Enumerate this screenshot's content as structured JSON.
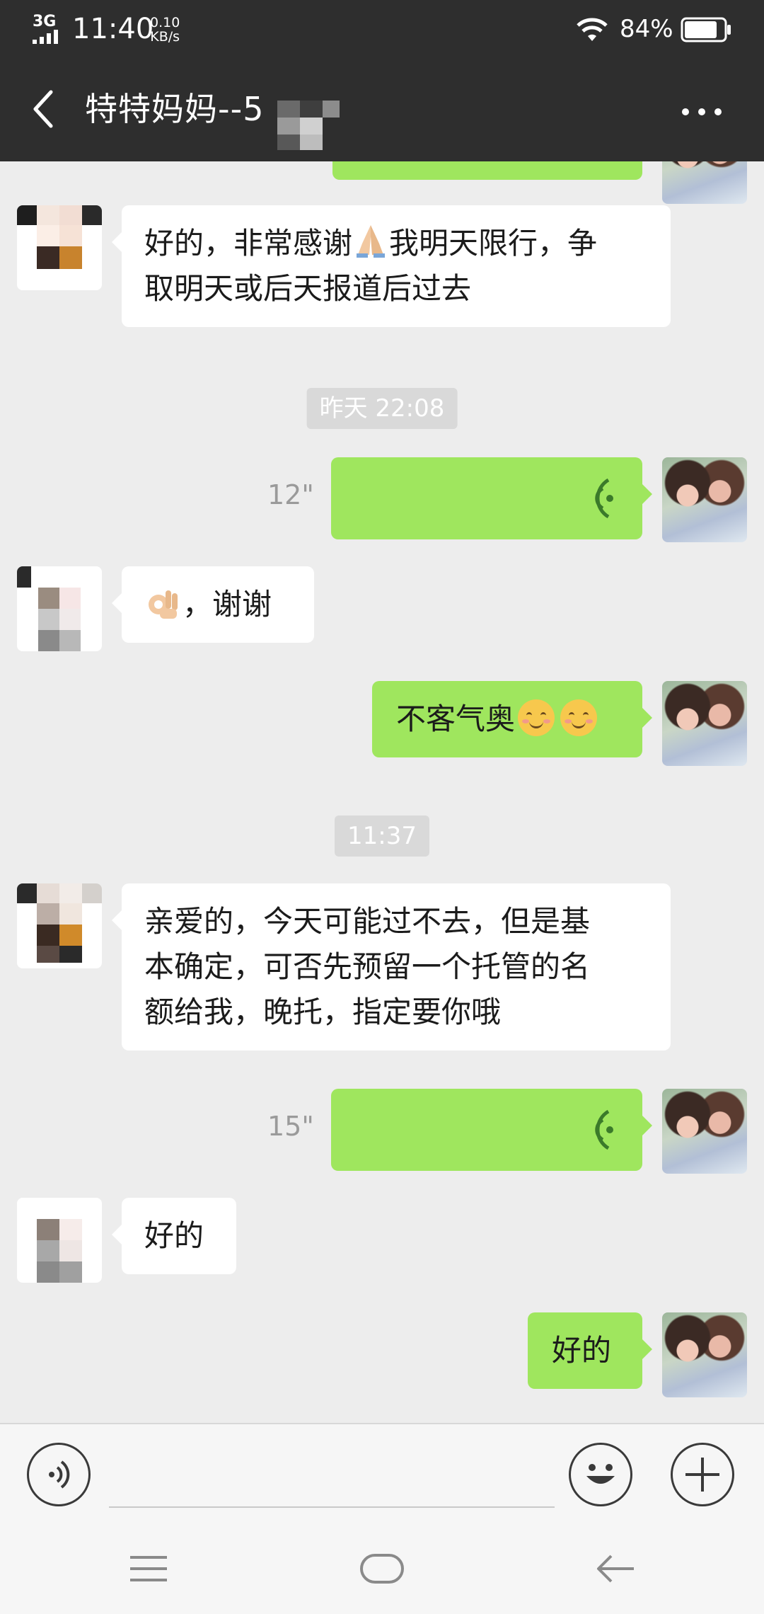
{
  "status_bar": {
    "network": "3G",
    "time": "11:40",
    "speed_value": "0.10",
    "speed_unit": "KB/s",
    "battery_percent": "84%",
    "battery_level": 0.84
  },
  "header": {
    "title": "特特妈妈--5",
    "back_icon": "chevron-left-icon",
    "more_icon": "more-dots-icon"
  },
  "messages": [
    {
      "type": "text",
      "side": "in",
      "line1_a": "好的，非常感谢",
      "emoji": "folded-hands",
      "line1_b": "我明天限行，争",
      "line2": "取明天或后天报道后过去"
    },
    {
      "type": "time",
      "text": "昨天 22:08"
    },
    {
      "type": "voice",
      "side": "out",
      "duration": "12\""
    },
    {
      "type": "text",
      "side": "in",
      "emoji": "ok-hand",
      "text": "，谢谢"
    },
    {
      "type": "text",
      "side": "out",
      "text": "不客气奥",
      "emoji": "smiling-face"
    },
    {
      "type": "time",
      "text": "11:37"
    },
    {
      "type": "text",
      "side": "in",
      "line1": "亲爱的，今天可能过不去，但是基",
      "line2": "本确定，可否先预留一个托管的名",
      "line3": "额给我，晚托，指定要你哦"
    },
    {
      "type": "voice",
      "side": "out",
      "duration": "15\""
    },
    {
      "type": "text",
      "side": "in",
      "text": "好的"
    },
    {
      "type": "text",
      "side": "out",
      "text": "好的"
    }
  ],
  "input_bar": {
    "voice_icon": "voice-input-icon",
    "emoji_icon": "emoji-icon",
    "plus_icon": "plus-icon"
  },
  "nav_bar": {
    "menu_icon": "menu-icon",
    "home_icon": "home-icon",
    "back_icon": "back-arrow-icon"
  },
  "colors": {
    "header_bg": "#2e2e2e",
    "chat_bg": "#ededed",
    "outgoing_bubble": "#9fe65e",
    "incoming_bubble": "#ffffff"
  }
}
